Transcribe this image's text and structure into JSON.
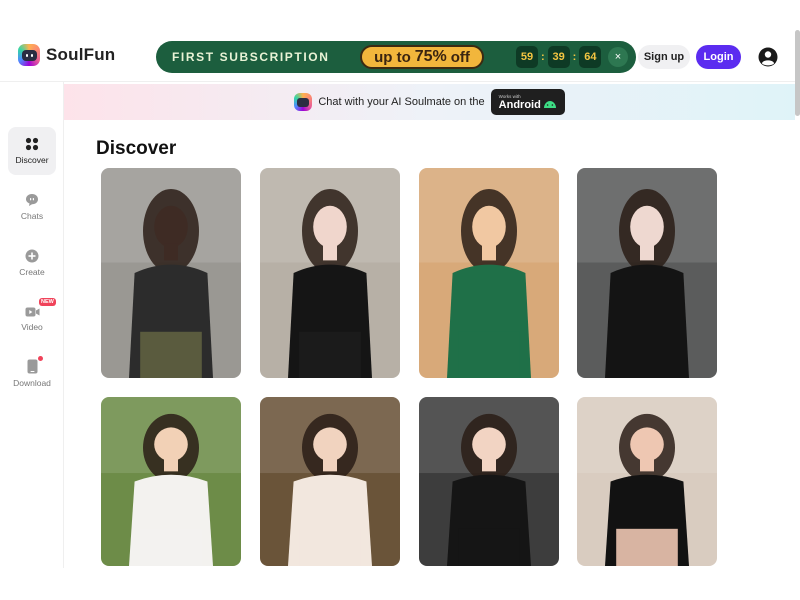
{
  "header": {
    "brand": "SoulFun",
    "promo": {
      "title": "FIRST SUBSCRIPTION",
      "pill_up": "up to",
      "pill_pct": "75%",
      "pill_off": "off",
      "timer": [
        "59",
        "39",
        "64"
      ],
      "close": "×"
    },
    "signup_label": "Sign up",
    "login_label": "Login"
  },
  "sidebar": {
    "items": [
      {
        "label": "Discover",
        "icon": "grid-icon",
        "active": true
      },
      {
        "label": "Chats",
        "icon": "chat-icon"
      },
      {
        "label": "Create",
        "icon": "plus-circle-icon"
      },
      {
        "label": "Video",
        "icon": "video-icon",
        "badge": "NEW"
      },
      {
        "label": "Download",
        "icon": "phone-icon",
        "dot": true
      }
    ]
  },
  "banner": {
    "text": "Chat with your AI Soulmate on the",
    "store_small": "Works with",
    "store_big": "Android"
  },
  "main": {
    "title": "Discover"
  },
  "cards": [
    {
      "name": "character-card-1",
      "bg": "#9a9893",
      "subject": "#3e2b24",
      "clothes": "#2c2c2c",
      "lower": "#5f6040"
    },
    {
      "name": "character-card-2",
      "bg": "#b7b0a6",
      "subject": "#f0d6cc",
      "clothes": "#151515",
      "lower": "#1c1c1c"
    },
    {
      "name": "character-card-3",
      "bg": "#d8a979",
      "subject": "#f1c8a2",
      "clothes": "#1f7048",
      "lower": "#1f7048"
    },
    {
      "name": "character-card-4",
      "bg": "#5b5c5c",
      "subject": "#eed8d0",
      "clothes": "#141414",
      "lower": "#141414"
    },
    {
      "name": "character-card-5",
      "bg": "#6d8c48",
      "subject": "#f2d1b6",
      "clothes": "#f3f2ef",
      "lower": "#f3f2ef"
    },
    {
      "name": "character-card-6",
      "bg": "#6a5439",
      "subject": "#f1d3bf",
      "clothes": "#f2e7de",
      "lower": "#f2e7de"
    },
    {
      "name": "character-card-7",
      "bg": "#3d3d3d",
      "subject": "#f2d4c3",
      "clothes": "#151515",
      "lower": "#151515"
    },
    {
      "name": "character-card-8",
      "bg": "#d9ccc0",
      "subject": "#eec7b2",
      "clothes": "#121212",
      "lower": "#eec7b2"
    }
  ]
}
